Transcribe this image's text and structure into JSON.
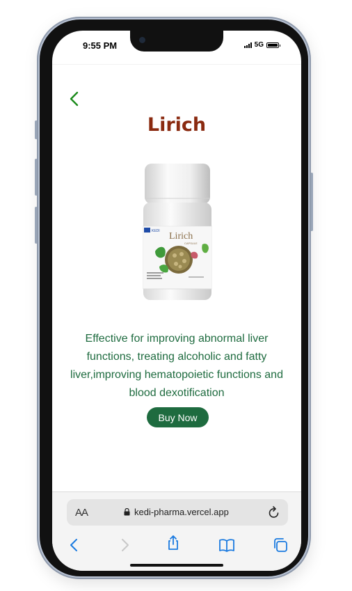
{
  "status_bar": {
    "time": "9:55 PM",
    "network": "5G"
  },
  "product": {
    "name": "Lirich",
    "label_brand": "KEDI",
    "label_name": "Lirich",
    "label_subtitle": "CAPSULE",
    "description": "Effective for improving abnormal liver functions, treating alcoholic and fatty liver,improving hematopoietic functions and blood dexotification",
    "buy_label": "Buy Now"
  },
  "browser": {
    "text_size_label": "AA",
    "url": "kedi-pharma.vercel.app"
  },
  "colors": {
    "title": "#8a2a10",
    "accent_green": "#1e6b3f",
    "back_arrow": "#1a8a1a",
    "toolbar_blue": "#1a7ae0"
  },
  "icons": {
    "back": "chevron-left-icon",
    "lock": "lock-icon",
    "reload": "reload-icon",
    "nav_back": "chevron-left-icon",
    "nav_forward": "chevron-right-icon",
    "share": "share-icon",
    "bookmarks": "book-icon",
    "tabs": "tabs-icon"
  }
}
